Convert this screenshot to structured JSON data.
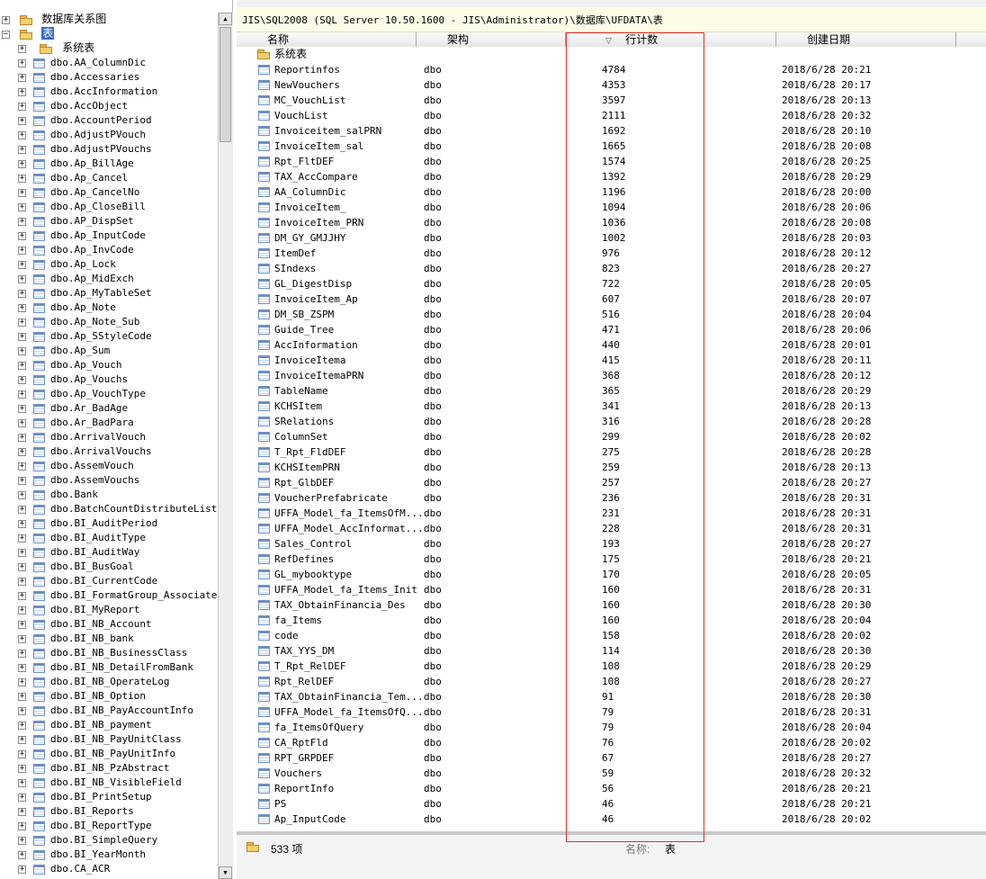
{
  "tree": {
    "root_folder": "数据库关系图",
    "tables_node": "表",
    "system_folder": "系统表",
    "items": [
      "dbo.AA_ColumnDic",
      "dbo.Accessaries",
      "dbo.AccInformation",
      "dbo.AccObject",
      "dbo.AccountPeriod",
      "dbo.AdjustPVouch",
      "dbo.AdjustPVouchs",
      "dbo.Ap_BillAge",
      "dbo.Ap_Cancel",
      "dbo.Ap_CancelNo",
      "dbo.Ap_CloseBill",
      "dbo.AP_DispSet",
      "dbo.Ap_InputCode",
      "dbo.Ap_InvCode",
      "dbo.Ap_Lock",
      "dbo.Ap_MidExch",
      "dbo.Ap_MyTableSet",
      "dbo.Ap_Note",
      "dbo.Ap_Note_Sub",
      "dbo.Ap_SStyleCode",
      "dbo.Ap_Sum",
      "dbo.Ap_Vouch",
      "dbo.Ap_Vouchs",
      "dbo.Ap_VouchType",
      "dbo.Ar_BadAge",
      "dbo.Ar_BadPara",
      "dbo.ArrivalVouch",
      "dbo.ArrivalVouchs",
      "dbo.AssemVouch",
      "dbo.AssemVouchs",
      "dbo.Bank",
      "dbo.BatchCountDistributeList",
      "dbo.BI_AuditPeriod",
      "dbo.BI_AuditType",
      "dbo.BI_AuditWay",
      "dbo.BI_BusGoal",
      "dbo.BI_CurrentCode",
      "dbo.BI_FormatGroup_Associate",
      "dbo.BI_MyReport",
      "dbo.BI_NB_Account",
      "dbo.BI_NB_bank",
      "dbo.BI_NB_BusinessClass",
      "dbo.BI_NB_DetailFromBank",
      "dbo.BI_NB_OperateLog",
      "dbo.BI_NB_Option",
      "dbo.BI_NB_PayAccountInfo",
      "dbo.BI_NB_payment",
      "dbo.BI_NB_PayUnitClass",
      "dbo.BI_NB_PayUnitInfo",
      "dbo.BI_NB_PzAbstract",
      "dbo.BI_NB_VisibleField",
      "dbo.BI_PrintSetup",
      "dbo.BI_Reports",
      "dbo.BI_ReportType",
      "dbo.BI_SimpleQuery",
      "dbo.BI_YearMonth",
      "dbo.CA_ACR"
    ]
  },
  "path": "JIS\\SQL2008 (SQL Server 10.50.1600 - JIS\\Administrator)\\数据库\\UFDATA\\表",
  "columns": {
    "name": "名称",
    "schema": "架构",
    "rowcount": "行计数",
    "created": "创建日期",
    "sort_glyph": "▽"
  },
  "system_folder_row": "系统表",
  "rows": [
    [
      "Reportinfos",
      "dbo",
      "4784",
      "2018/6/28 20:21"
    ],
    [
      "NewVouchers",
      "dbo",
      "4353",
      "2018/6/28 20:17"
    ],
    [
      "MC_VouchList",
      "dbo",
      "3597",
      "2018/6/28 20:13"
    ],
    [
      "VouchList",
      "dbo",
      "2111",
      "2018/6/28 20:32"
    ],
    [
      "Invoiceitem_salPRN",
      "dbo",
      "1692",
      "2018/6/28 20:10"
    ],
    [
      "InvoiceItem_sal",
      "dbo",
      "1665",
      "2018/6/28 20:08"
    ],
    [
      "Rpt_FltDEF",
      "dbo",
      "1574",
      "2018/6/28 20:25"
    ],
    [
      "TAX_AccCompare",
      "dbo",
      "1392",
      "2018/6/28 20:29"
    ],
    [
      "AA_ColumnDic",
      "dbo",
      "1196",
      "2018/6/28 20:00"
    ],
    [
      "InvoiceItem_",
      "dbo",
      "1094",
      "2018/6/28 20:06"
    ],
    [
      "InvoiceItem_PRN",
      "dbo",
      "1036",
      "2018/6/28 20:08"
    ],
    [
      "DM_GY_GMJJHY",
      "dbo",
      "1002",
      "2018/6/28 20:03"
    ],
    [
      "ItemDef",
      "dbo",
      "976",
      "2018/6/28 20:12"
    ],
    [
      "SIndexs",
      "dbo",
      "823",
      "2018/6/28 20:27"
    ],
    [
      "GL_DigestDisp",
      "dbo",
      "722",
      "2018/6/28 20:05"
    ],
    [
      "InvoiceItem_Ap",
      "dbo",
      "607",
      "2018/6/28 20:07"
    ],
    [
      "DM_SB_ZSPM",
      "dbo",
      "516",
      "2018/6/28 20:04"
    ],
    [
      "Guide_Tree",
      "dbo",
      "471",
      "2018/6/28 20:06"
    ],
    [
      "AccInformation",
      "dbo",
      "440",
      "2018/6/28 20:01"
    ],
    [
      "InvoiceItema",
      "dbo",
      "415",
      "2018/6/28 20:11"
    ],
    [
      "InvoiceItemaPRN",
      "dbo",
      "368",
      "2018/6/28 20:12"
    ],
    [
      "TableName",
      "dbo",
      "365",
      "2018/6/28 20:29"
    ],
    [
      "KCHSItem",
      "dbo",
      "341",
      "2018/6/28 20:13"
    ],
    [
      "SRelations",
      "dbo",
      "316",
      "2018/6/28 20:28"
    ],
    [
      "ColumnSet",
      "dbo",
      "299",
      "2018/6/28 20:02"
    ],
    [
      "T_Rpt_FldDEF",
      "dbo",
      "275",
      "2018/6/28 20:28"
    ],
    [
      "KCHSItemPRN",
      "dbo",
      "259",
      "2018/6/28 20:13"
    ],
    [
      "Rpt_GlbDEF",
      "dbo",
      "257",
      "2018/6/28 20:27"
    ],
    [
      "VoucherPrefabricate",
      "dbo",
      "236",
      "2018/6/28 20:31"
    ],
    [
      "UFFA_Model_fa_ItemsOfM...",
      "dbo",
      "231",
      "2018/6/28 20:31"
    ],
    [
      "UFFA_Model_AccInformat...",
      "dbo",
      "228",
      "2018/6/28 20:31"
    ],
    [
      "Sales_Control",
      "dbo",
      "193",
      "2018/6/28 20:27"
    ],
    [
      "RefDefines",
      "dbo",
      "175",
      "2018/6/28 20:21"
    ],
    [
      "GL_mybooktype",
      "dbo",
      "170",
      "2018/6/28 20:05"
    ],
    [
      "UFFA_Model_fa_Items_Init",
      "dbo",
      "160",
      "2018/6/28 20:31"
    ],
    [
      "TAX_ObtainFinancia_Des",
      "dbo",
      "160",
      "2018/6/28 20:30"
    ],
    [
      "fa_Items",
      "dbo",
      "160",
      "2018/6/28 20:04"
    ],
    [
      "code",
      "dbo",
      "158",
      "2018/6/28 20:02"
    ],
    [
      "TAX_YYS_DM",
      "dbo",
      "114",
      "2018/6/28 20:30"
    ],
    [
      "T_Rpt_RelDEF",
      "dbo",
      "108",
      "2018/6/28 20:29"
    ],
    [
      "Rpt_RelDEF",
      "dbo",
      "108",
      "2018/6/28 20:27"
    ],
    [
      "TAX_ObtainFinancia_Tem...",
      "dbo",
      "91",
      "2018/6/28 20:30"
    ],
    [
      "UFFA_Model_fa_ItemsOfQ...",
      "dbo",
      "79",
      "2018/6/28 20:31"
    ],
    [
      "fa_ItemsOfQuery",
      "dbo",
      "79",
      "2018/6/28 20:04"
    ],
    [
      "CA_RptFld",
      "dbo",
      "76",
      "2018/6/28 20:02"
    ],
    [
      "RPT_GRPDEF",
      "dbo",
      "67",
      "2018/6/28 20:27"
    ],
    [
      "Vouchers",
      "dbo",
      "59",
      "2018/6/28 20:32"
    ],
    [
      "ReportInfo",
      "dbo",
      "56",
      "2018/6/28 20:21"
    ],
    [
      "PS",
      "dbo",
      "46",
      "2018/6/28 20:21"
    ],
    [
      "Ap_InputCode",
      "dbo",
      "46",
      "2018/6/28 20:02"
    ]
  ],
  "status": {
    "count": "533 项",
    "name_label": "名称:",
    "name_value": "表"
  },
  "colors": {
    "highlight_box": "#e0302c",
    "path_bg": "#fdfce7"
  }
}
